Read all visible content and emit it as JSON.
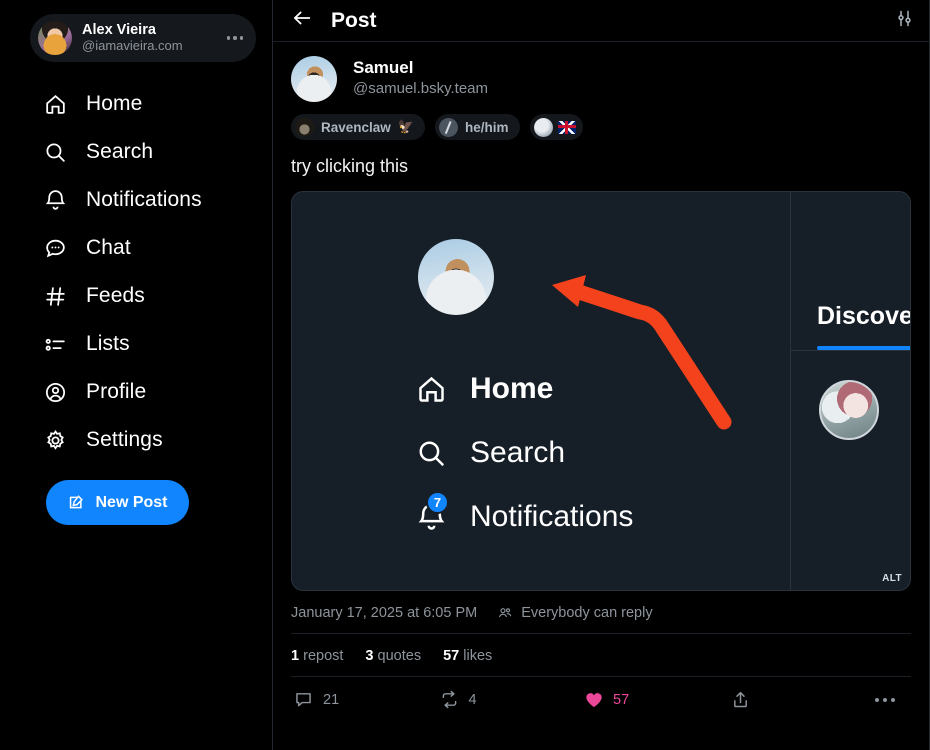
{
  "sidebar": {
    "profile": {
      "name": "Alex Vieira",
      "handle": "@iamavieira.com",
      "menu_icon": "ellipsis-icon",
      "avatar": "user-avatar"
    },
    "items": [
      {
        "label": "Home",
        "icon": "home-icon"
      },
      {
        "label": "Search",
        "icon": "search-icon"
      },
      {
        "label": "Notifications",
        "icon": "bell-icon"
      },
      {
        "label": "Chat",
        "icon": "chat-bubble-icon"
      },
      {
        "label": "Feeds",
        "icon": "hash-icon"
      },
      {
        "label": "Lists",
        "icon": "list-icon"
      },
      {
        "label": "Profile",
        "icon": "person-circle-icon"
      },
      {
        "label": "Settings",
        "icon": "gear-icon"
      }
    ],
    "new_post_label": "New Post",
    "new_post_icon": "compose-icon",
    "accent_color": "#1185fe"
  },
  "topbar": {
    "title": "Post",
    "back_icon": "arrow-left-icon",
    "filter_icon": "sliders-icon"
  },
  "post": {
    "author": {
      "name": "Samuel",
      "handle": "@samuel.bsky.team",
      "avatar": "author-avatar"
    },
    "badges": [
      {
        "label": "Ravenclaw",
        "emoji": "🦅",
        "icon": "ravenclaw-crest-icon"
      },
      {
        "label": "he/him",
        "icon": "pronoun-icon"
      },
      {
        "label": "",
        "icon": "globe-icon",
        "flag": "uk-flag-icon"
      }
    ],
    "text": "try clicking this",
    "embed": {
      "alt_badge": "ALT",
      "nav": [
        {
          "label": "Home",
          "icon": "home-icon",
          "bold": true
        },
        {
          "label": "Search",
          "icon": "search-icon",
          "bold": false
        },
        {
          "label": "Notifications",
          "icon": "bell-icon",
          "bold": false,
          "badge": "7"
        }
      ],
      "right_tab": "Discover",
      "arrow_color": "#f4431c"
    },
    "timestamp": "January 17, 2025 at 6:05 PM",
    "reply_setting": "Everybody can reply",
    "reply_icon": "people-icon",
    "stats": {
      "reposts_count": "1",
      "reposts_label": "repost",
      "quotes_count": "3",
      "quotes_label": "quotes",
      "likes_count": "57",
      "likes_label": "likes"
    },
    "actions": {
      "reply_count": "21",
      "repost_count": "4",
      "like_count": "57",
      "like_color": "#ec4899",
      "reply_icon": "comment-icon",
      "repost_icon": "repost-icon",
      "like_icon": "heart-filled-icon",
      "share_icon": "share-icon",
      "more_icon": "ellipsis-icon"
    }
  }
}
